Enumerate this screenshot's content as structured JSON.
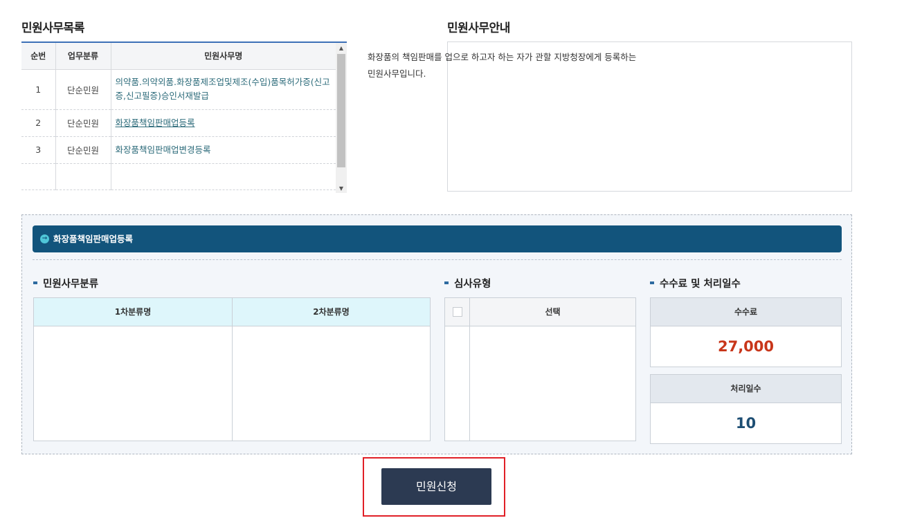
{
  "list_section": {
    "title": "민원사무목록",
    "headers": [
      "순번",
      "업무분류",
      "민원사무명"
    ],
    "rows": [
      {
        "no": "1",
        "category": "단순민원",
        "name": "의약품.의약외품.화장품제조업및제조(수입)품목허가증(신고증,신고필증)승인서재발급"
      },
      {
        "no": "2",
        "category": "단순민원",
        "name": "화장품책임판매업등록"
      },
      {
        "no": "3",
        "category": "단순민원",
        "name": "화장품책임판매업변경등록"
      }
    ]
  },
  "guide_section": {
    "title": "민원사무안내",
    "text_line1": "화장품의 책임판매를 업으로 하고자 하는 자가 관할 지방청장에게 등록하는",
    "text_line2": "민원사무입니다."
  },
  "detail_panel": {
    "header": "화장품책임판매업등록",
    "classification": {
      "title": "민원사무분류",
      "col1": "1차분류명",
      "col2": "2차분류명"
    },
    "exam": {
      "title": "심사유형",
      "col": "선택"
    },
    "fee": {
      "title": "수수료 및 처리일수",
      "fee_label": "수수료",
      "fee_value": "27,000",
      "days_label": "처리일수",
      "days_value": "10"
    }
  },
  "apply_button": "민원신청",
  "colors": {
    "header_bar": "#12547c",
    "fee_value": "#c8361a",
    "days_value": "#1d4e73",
    "apply_button": "#2c3a52",
    "highlight": "#e01f26"
  }
}
